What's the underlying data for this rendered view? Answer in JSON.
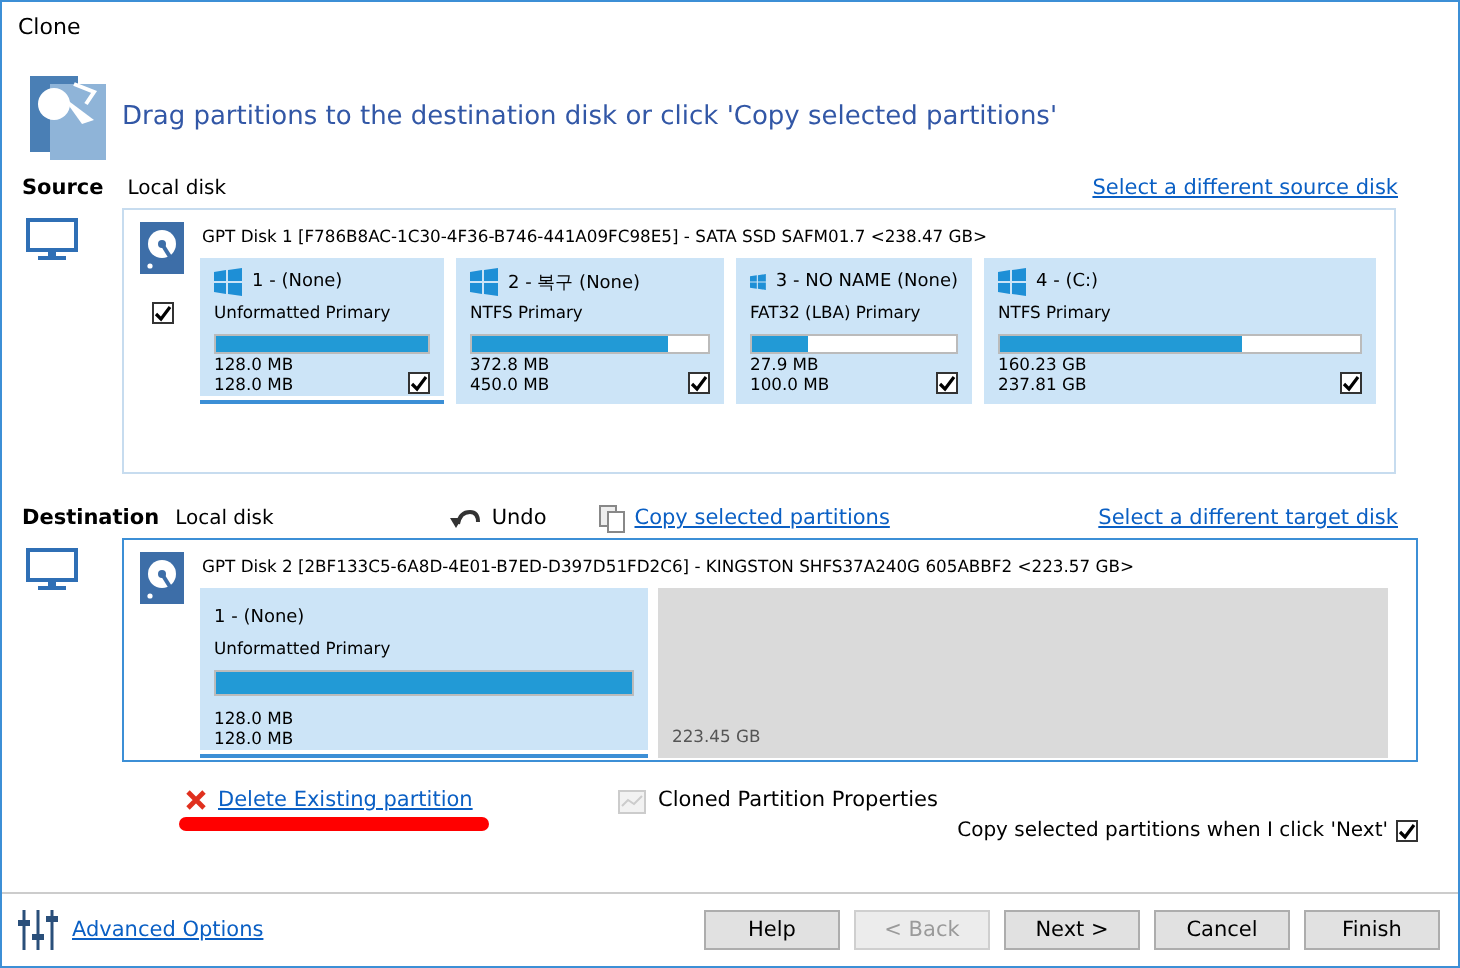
{
  "window": {
    "title": "Clone"
  },
  "instruction": "Drag partitions to the destination disk or click 'Copy selected partitions'",
  "source": {
    "label": "Source",
    "disk_type": "Local disk",
    "link": "Select a different source disk",
    "disk": {
      "header": "GPT Disk 1 [F786B8AC-1C30-4F36-B746-441A09FC98E5] - SATA SSD SAFM01.7  <238.47 GB>",
      "checked": true,
      "partitions": [
        {
          "name": "1 -  (None)",
          "type": "Unformatted Primary",
          "level": 1,
          "used": "128.0 MB",
          "total": "128.0 MB",
          "checked": true,
          "selected": true
        },
        {
          "name": "2 - 복구 (None)",
          "type": "NTFS Primary",
          "level": 0.83,
          "used": "372.8 MB",
          "total": "450.0 MB",
          "checked": true,
          "selected": false
        },
        {
          "name": "3 - NO NAME (None)",
          "type": "FAT32 (LBA) Primary",
          "level": 0.27,
          "used": "27.9 MB",
          "total": "100.0 MB",
          "checked": true,
          "selected": false
        },
        {
          "name": "4 -  (C:)",
          "type": "NTFS Primary",
          "level": 0.67,
          "used": "160.23 GB",
          "total": "237.81 GB",
          "checked": true,
          "selected": false
        }
      ]
    }
  },
  "destination": {
    "label": "Destination",
    "disk_type": "Local disk",
    "undo": "Undo",
    "copy_link": "Copy selected partitions",
    "link": "Select a different target disk",
    "disk": {
      "header": "GPT Disk 2 [2BF133C5-6A8D-4E01-B7ED-D397D51FD2C6] - KINGSTON SHFS37A240G 605ABBF2  <223.57 GB>",
      "partitions": [
        {
          "kind": "partition",
          "name": "1 -  (None)",
          "type": "Unformatted Primary",
          "level": 1,
          "used": "128.0 MB",
          "total": "128.0 MB",
          "selected": true
        },
        {
          "kind": "unallocated",
          "size": "223.45 GB"
        }
      ]
    }
  },
  "delete_link": "Delete Existing partition",
  "properties": "Cloned Partition Properties",
  "copy_on_next": {
    "label": "Copy selected partitions when I click 'Next'",
    "checked": true
  },
  "advanced": "Advanced Options",
  "buttons": [
    {
      "label": "Help",
      "disabled": false
    },
    {
      "label": "< Back",
      "disabled": true
    },
    {
      "label": "Next >",
      "disabled": false
    },
    {
      "label": "Cancel",
      "disabled": false
    },
    {
      "label": "Finish",
      "disabled": false
    }
  ]
}
